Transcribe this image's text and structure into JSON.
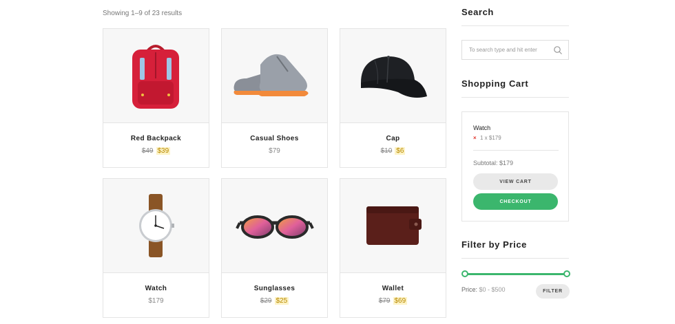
{
  "results": {
    "text": "Showing 1–9 of 23 results"
  },
  "products": [
    {
      "name": "Red Backpack",
      "old_price": "$49",
      "price": "$39",
      "icon": "backpack-image"
    },
    {
      "name": "Casual Shoes",
      "old_price": "",
      "price": "$79",
      "icon": "shoes-image"
    },
    {
      "name": "Cap",
      "old_price": "$10",
      "price": "$6",
      "icon": "cap-image"
    },
    {
      "name": "Watch",
      "old_price": "",
      "price": "$179",
      "icon": "watch-image"
    },
    {
      "name": "Sunglasses",
      "old_price": "$29",
      "price": "$25",
      "icon": "sunglasses-image"
    },
    {
      "name": "Wallet",
      "old_price": "$79",
      "price": "$69",
      "icon": "wallet-image"
    }
  ],
  "sidebar": {
    "search": {
      "heading": "Search",
      "placeholder": "To search type and hit enter"
    },
    "cart": {
      "heading": "Shopping Cart",
      "item_name": "Watch",
      "item_remove": "×",
      "item_qty": "1 x $179",
      "subtotal": "Subtotal: $179",
      "view_cart_label": "VIEW CART",
      "checkout_label": "CHECKOUT"
    },
    "filter": {
      "heading": "Filter by Price",
      "price_label": "Price:",
      "price_range": "$0 - $500",
      "slider_min_fraction": 0,
      "slider_max_fraction": 1,
      "button_label": "FILTER"
    }
  },
  "colors": {
    "accent": "#3bb66d",
    "sale_highlight": "#fdf3c7",
    "remove": "#e0342c"
  }
}
